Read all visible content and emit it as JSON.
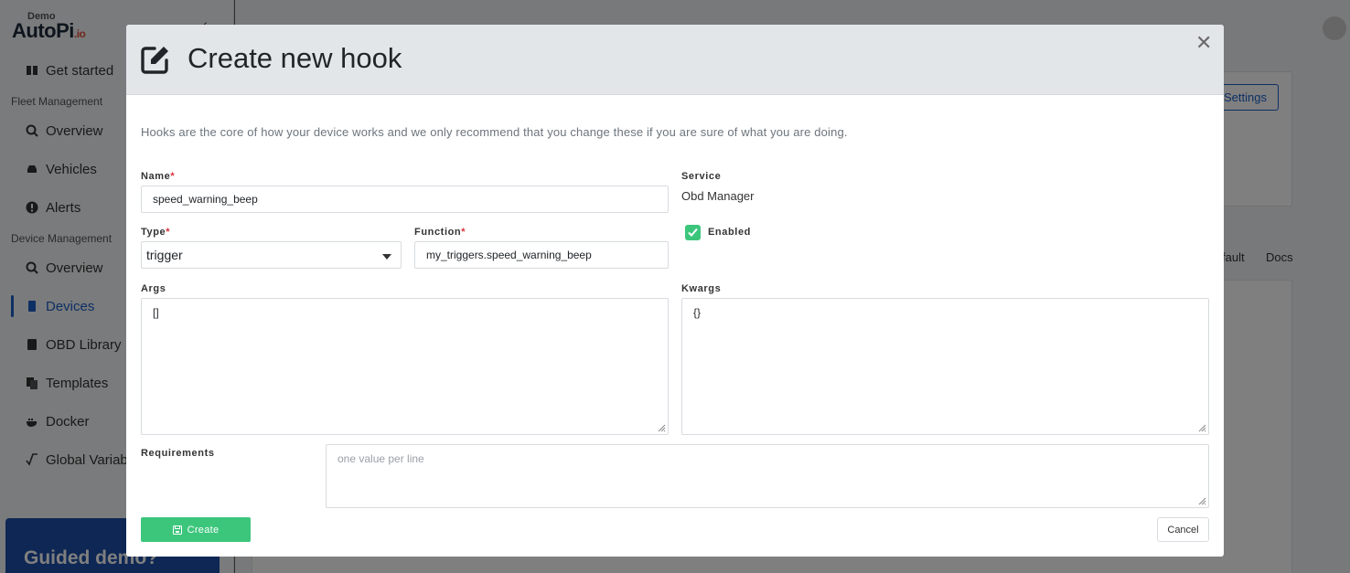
{
  "app": {
    "logo_demo": "Demo",
    "logo_main": "AutoPi",
    "logo_suffix": ".io"
  },
  "sidebar": {
    "get_started": "Get started",
    "fleet_section": "Fleet Management",
    "fleet_items": [
      {
        "label": "Overview",
        "icon": "search-icon"
      },
      {
        "label": "Vehicles",
        "icon": "car-icon"
      },
      {
        "label": "Alerts",
        "icon": "alert-icon"
      }
    ],
    "device_section": "Device Management",
    "device_items": [
      {
        "label": "Overview",
        "icon": "search-icon"
      },
      {
        "label": "Devices",
        "icon": "device-icon"
      },
      {
        "label": "OBD Library",
        "icon": "book-icon"
      },
      {
        "label": "Templates",
        "icon": "templates-icon"
      },
      {
        "label": "Docker",
        "icon": "docker-icon"
      },
      {
        "label": "Global Variab",
        "icon": "variable-icon"
      }
    ],
    "active_item": "Devices",
    "guided_demo": "Guided demo?"
  },
  "background": {
    "settings_button": "Settings",
    "tab_default": "fault",
    "tab_docs": "Docs"
  },
  "modal": {
    "title": "Create new hook",
    "intro": "Hooks are the core of how your device works and we only recommend that you change these if you are sure of what you are doing.",
    "name_label": "Name",
    "name_value": "speed_warning_beep",
    "service_label": "Service",
    "service_value": "Obd Manager",
    "type_label": "Type",
    "type_value": "trigger",
    "function_label": "Function",
    "function_value": "my_triggers.speed_warning_beep",
    "enabled_label": "Enabled",
    "enabled": true,
    "args_label": "Args",
    "args_value": "[]",
    "kwargs_label": "Kwargs",
    "kwargs_value": "{}",
    "requirements_label": "Requirements",
    "requirements_placeholder": "one value per line",
    "create_button": "Create",
    "cancel_button": "Cancel",
    "required_marker": "*"
  },
  "colors": {
    "primary": "#1a5fc8",
    "success": "#3cc67c",
    "required": "#d9323a"
  }
}
